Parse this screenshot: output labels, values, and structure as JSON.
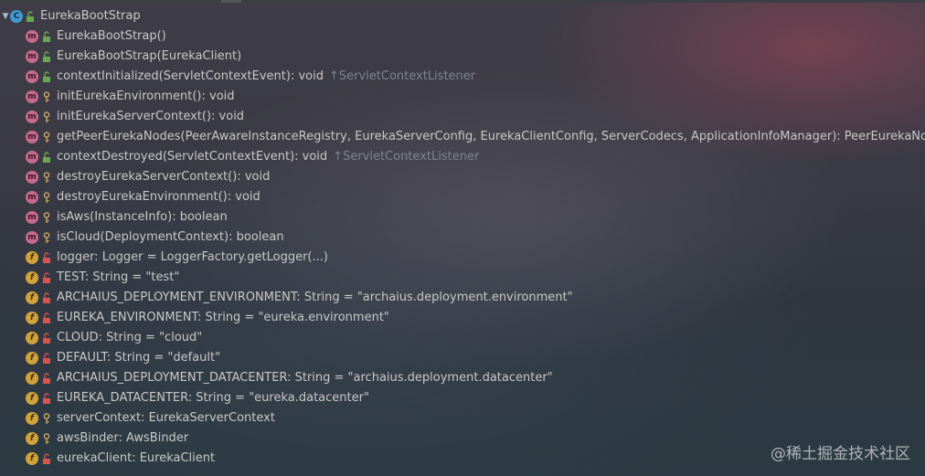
{
  "watermark": "@稀土掘金技术社区",
  "root": {
    "label": "EurekaBootStrap",
    "icon": "class-icon"
  },
  "items": [
    {
      "label": "EurekaBootStrap()",
      "meta": "",
      "kind": "method",
      "visibility": "public"
    },
    {
      "label": "EurekaBootStrap(EurekaClient)",
      "meta": "",
      "kind": "method",
      "visibility": "public"
    },
    {
      "label": "contextInitialized(ServletContextEvent): void",
      "meta": "↑ServletContextListener",
      "kind": "method",
      "visibility": "public"
    },
    {
      "label": "initEurekaEnvironment(): void",
      "meta": "",
      "kind": "method",
      "visibility": "protected"
    },
    {
      "label": "initEurekaServerContext(): void",
      "meta": "",
      "kind": "method",
      "visibility": "protected"
    },
    {
      "label": "getPeerEurekaNodes(PeerAwareInstanceRegistry, EurekaServerConfig, EurekaClientConfig, ServerCodecs, ApplicationInfoManager): PeerEurekaNodes",
      "meta": "",
      "kind": "method",
      "visibility": "protected"
    },
    {
      "label": "contextDestroyed(ServletContextEvent): void",
      "meta": "↑ServletContextListener",
      "kind": "method",
      "visibility": "public"
    },
    {
      "label": "destroyEurekaServerContext(): void",
      "meta": "",
      "kind": "method",
      "visibility": "protected"
    },
    {
      "label": "destroyEurekaEnvironment(): void",
      "meta": "",
      "kind": "method",
      "visibility": "protected"
    },
    {
      "label": "isAws(InstanceInfo): boolean",
      "meta": "",
      "kind": "method",
      "visibility": "protected"
    },
    {
      "label": "isCloud(DeploymentContext): boolean",
      "meta": "",
      "kind": "method",
      "visibility": "protected"
    },
    {
      "label": "logger: Logger = LoggerFactory.getLogger(...)",
      "meta": "",
      "kind": "field",
      "visibility": "private"
    },
    {
      "label": "TEST: String = \"test\"",
      "meta": "",
      "kind": "field",
      "visibility": "private"
    },
    {
      "label": "ARCHAIUS_DEPLOYMENT_ENVIRONMENT: String = \"archaius.deployment.environment\"",
      "meta": "",
      "kind": "field",
      "visibility": "private"
    },
    {
      "label": "EUREKA_ENVIRONMENT: String = \"eureka.environment\"",
      "meta": "",
      "kind": "field",
      "visibility": "private"
    },
    {
      "label": "CLOUD: String = \"cloud\"",
      "meta": "",
      "kind": "field",
      "visibility": "private"
    },
    {
      "label": "DEFAULT: String = \"default\"",
      "meta": "",
      "kind": "field",
      "visibility": "private"
    },
    {
      "label": "ARCHAIUS_DEPLOYMENT_DATACENTER: String = \"archaius.deployment.datacenter\"",
      "meta": "",
      "kind": "field",
      "visibility": "private"
    },
    {
      "label": "EUREKA_DATACENTER: String = \"eureka.datacenter\"",
      "meta": "",
      "kind": "field",
      "visibility": "private"
    },
    {
      "label": "serverContext: EurekaServerContext",
      "meta": "",
      "kind": "field",
      "visibility": "protected"
    },
    {
      "label": "awsBinder: AwsBinder",
      "meta": "",
      "kind": "field",
      "visibility": "protected"
    },
    {
      "label": "eurekaClient: EurekaClient",
      "meta": "",
      "kind": "field",
      "visibility": "private"
    }
  ],
  "colors": {
    "method": "#c76a8f",
    "field": "#d1a23a",
    "class": "#3f9ad6",
    "public": "#6aa84f",
    "protected": "#c9a86a",
    "private": "#d9534f"
  }
}
